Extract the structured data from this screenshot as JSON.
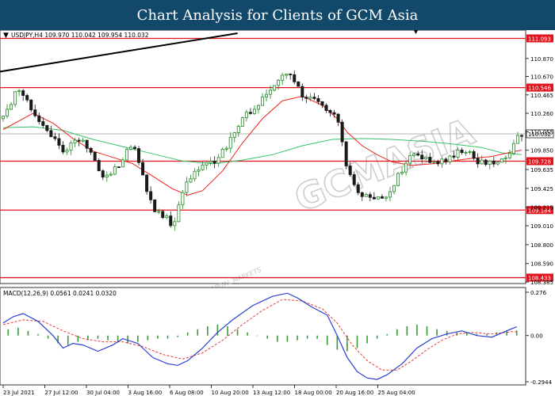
{
  "header": {
    "title": "Chart Analysis for Clients of GCM Asia"
  },
  "watermark": {
    "text": "GCMASIA",
    "subtext": "GLOBAL CAPITAL MARKETS"
  },
  "colors": {
    "banner": "#12496b",
    "candle_up": "#1f8a24",
    "candle_down": "#1a1a1a",
    "ma_fast": "#e8241c",
    "ma_slow": "#35c46a",
    "level_line": "#e0141c",
    "label_bg": "#e0141c",
    "trendline": "#000000",
    "macd_signal": "#e53a3a",
    "macd_line": "#2a3fd1",
    "macd_hist": "#3a9a3a"
  },
  "chart_data": [
    {
      "type": "candlestick",
      "symbol_info": "USDJPY,H4  109.970 110.042 109.954 110.032",
      "ylim": [
        108.385,
        111.15
      ],
      "y_ticks": [
        "110.870",
        "110.670",
        "110.465",
        "110.260",
        "110.055",
        "109.850",
        "109.635",
        "109.425",
        "109.215",
        "109.010",
        "108.800",
        "108.590",
        "108.385"
      ],
      "x_ticks": [
        "23 Jul 2021",
        "27 Jul 12:00",
        "30 Jul 04:00",
        "3 Aug 16:00",
        "6 Aug 08:00",
        "10 Aug 20:00",
        "13 Aug 12:00",
        "18 Aug 00:00",
        "20 Aug 16:00",
        "25 Aug 04:00"
      ],
      "horizontal_levels": [
        "111.093",
        "110.546",
        "109.728",
        "109.184",
        "108.433"
      ],
      "current_price": "110.032",
      "close_path": [
        [
          0,
          110.2
        ],
        [
          1.5,
          110.55
        ],
        [
          3.5,
          110.2
        ],
        [
          6,
          109.85
        ],
        [
          8,
          109.98
        ],
        [
          10,
          109.55
        ],
        [
          11.5,
          109.65
        ],
        [
          13,
          109.95
        ],
        [
          15,
          109.2
        ],
        [
          16.5,
          109.1
        ],
        [
          17,
          108.97
        ],
        [
          18,
          109.4
        ],
        [
          19.5,
          109.65
        ],
        [
          21,
          109.7
        ],
        [
          22.5,
          109.9
        ],
        [
          24,
          110.2
        ],
        [
          25.5,
          110.35
        ],
        [
          27,
          110.55
        ],
        [
          28.5,
          110.72
        ],
        [
          30,
          110.46
        ],
        [
          32,
          110.35
        ],
        [
          33.5,
          110.25
        ],
        [
          34.5,
          109.65
        ],
        [
          35.5,
          109.4
        ],
        [
          37,
          109.3
        ],
        [
          38.5,
          109.35
        ],
        [
          39.5,
          109.55
        ],
        [
          41,
          109.8
        ],
        [
          42.5,
          109.75
        ],
        [
          44,
          109.72
        ],
        [
          45,
          109.8
        ],
        [
          46.5,
          109.85
        ],
        [
          47.5,
          109.7
        ],
        [
          49,
          109.72
        ],
        [
          50.5,
          109.78
        ],
        [
          51.5,
          110.0
        ],
        [
          52,
          110.032
        ]
      ],
      "ma_fast": [
        [
          0,
          110.08
        ],
        [
          3,
          110.26
        ],
        [
          5,
          110.15
        ],
        [
          7,
          109.98
        ],
        [
          9,
          109.84
        ],
        [
          11,
          109.77
        ],
        [
          13,
          109.7
        ],
        [
          15,
          109.56
        ],
        [
          17,
          109.42
        ],
        [
          18.5,
          109.35
        ],
        [
          20,
          109.4
        ],
        [
          22,
          109.62
        ],
        [
          24,
          109.93
        ],
        [
          26,
          110.2
        ],
        [
          28,
          110.4
        ],
        [
          30,
          110.45
        ],
        [
          32,
          110.35
        ],
        [
          33.5,
          110.2
        ],
        [
          34.5,
          110.05
        ],
        [
          36,
          109.9
        ],
        [
          37.5,
          109.8
        ],
        [
          39,
          109.72
        ],
        [
          41,
          109.68
        ],
        [
          43,
          109.7
        ],
        [
          45,
          109.73
        ],
        [
          47,
          109.76
        ],
        [
          49,
          109.78
        ],
        [
          51,
          109.83
        ],
        [
          52,
          109.85
        ]
      ],
      "ma_slow": [
        [
          0,
          110.1
        ],
        [
          3,
          110.11
        ],
        [
          6,
          110.07
        ],
        [
          9,
          109.97
        ],
        [
          12,
          109.89
        ],
        [
          15,
          109.81
        ],
        [
          18,
          109.73
        ],
        [
          21,
          109.7
        ],
        [
          24,
          109.74
        ],
        [
          27,
          109.8
        ],
        [
          30,
          109.9
        ],
        [
          33,
          109.97
        ],
        [
          36,
          109.98
        ],
        [
          39,
          109.97
        ],
        [
          42,
          109.95
        ],
        [
          45,
          109.92
        ],
        [
          48,
          109.88
        ],
        [
          50,
          109.82
        ],
        [
          52,
          109.8
        ]
      ],
      "trendline": [
        [
          -0.5,
          110.72
        ],
        [
          23.5,
          111.15
        ]
      ]
    },
    {
      "type": "macd",
      "label": "MACD(12,26,9) 0.0561 0.0241 0.0320",
      "ylim": [
        -0.2944,
        0.276
      ],
      "y_ticks": [
        "0.276",
        "0.00",
        "-0.2944"
      ],
      "macd_line": [
        [
          0,
          0.08
        ],
        [
          1,
          0.12
        ],
        [
          2,
          0.14
        ],
        [
          3.5,
          0.09
        ],
        [
          5,
          0.0
        ],
        [
          6,
          -0.08
        ],
        [
          7,
          -0.05
        ],
        [
          8,
          -0.06
        ],
        [
          9.5,
          -0.1
        ],
        [
          11,
          -0.06
        ],
        [
          12,
          -0.02
        ],
        [
          13.5,
          -0.05
        ],
        [
          15,
          -0.14
        ],
        [
          16.5,
          -0.18
        ],
        [
          17.5,
          -0.19
        ],
        [
          18.5,
          -0.16
        ],
        [
          20,
          -0.08
        ],
        [
          21.5,
          0.02
        ],
        [
          23,
          0.1
        ],
        [
          25,
          0.19
        ],
        [
          27,
          0.25
        ],
        [
          28.5,
          0.27
        ],
        [
          29.5,
          0.24
        ],
        [
          31,
          0.18
        ],
        [
          32.5,
          0.13
        ],
        [
          33.5,
          0.0
        ],
        [
          34.5,
          -0.14
        ],
        [
          35.5,
          -0.23
        ],
        [
          36.5,
          -0.27
        ],
        [
          37.5,
          -0.28
        ],
        [
          38.5,
          -0.25
        ],
        [
          40,
          -0.18
        ],
        [
          41.5,
          -0.08
        ],
        [
          43,
          -0.02
        ],
        [
          44.5,
          0.01
        ],
        [
          46,
          0.03
        ],
        [
          47.5,
          0.0
        ],
        [
          49,
          -0.01
        ],
        [
          50.5,
          0.03
        ],
        [
          51.5,
          0.056
        ]
      ],
      "signal_line": [
        [
          0,
          0.07
        ],
        [
          2,
          0.1
        ],
        [
          4,
          0.09
        ],
        [
          6,
          0.03
        ],
        [
          8,
          -0.02
        ],
        [
          10,
          -0.04
        ],
        [
          12,
          -0.04
        ],
        [
          14,
          -0.07
        ],
        [
          16,
          -0.12
        ],
        [
          18,
          -0.15
        ],
        [
          20,
          -0.11
        ],
        [
          22,
          -0.03
        ],
        [
          24,
          0.07
        ],
        [
          26,
          0.16
        ],
        [
          28,
          0.23
        ],
        [
          30,
          0.22
        ],
        [
          32,
          0.17
        ],
        [
          33.5,
          0.08
        ],
        [
          35,
          -0.06
        ],
        [
          36.5,
          -0.16
        ],
        [
          38,
          -0.22
        ],
        [
          39.5,
          -0.22
        ],
        [
          41,
          -0.16
        ],
        [
          42.5,
          -0.09
        ],
        [
          44,
          -0.03
        ],
        [
          45.5,
          0.01
        ],
        [
          47,
          0.02
        ],
        [
          49,
          0.01
        ],
        [
          51,
          0.024
        ],
        [
          51.5,
          0.0241
        ]
      ],
      "histogram": [
        0.04,
        0.05,
        0.03,
        0.01,
        -0.02,
        -0.05,
        -0.06,
        -0.04,
        -0.03,
        -0.02,
        -0.03,
        -0.04,
        -0.05,
        -0.04,
        -0.03,
        -0.02,
        -0.02,
        -0.01,
        0.02,
        0.04,
        0.06,
        0.07,
        0.06,
        0.04,
        0.02,
        0.0,
        -0.02,
        -0.04,
        -0.04,
        -0.03,
        -0.02,
        -0.02,
        -0.06,
        -0.09,
        -0.1,
        -0.08,
        -0.05,
        -0.02,
        0.01,
        0.04,
        0.06,
        0.07,
        0.06,
        0.04,
        0.03,
        0.02,
        0.02,
        0.01,
        0.01,
        0.02,
        0.03,
        0.032
      ]
    }
  ]
}
